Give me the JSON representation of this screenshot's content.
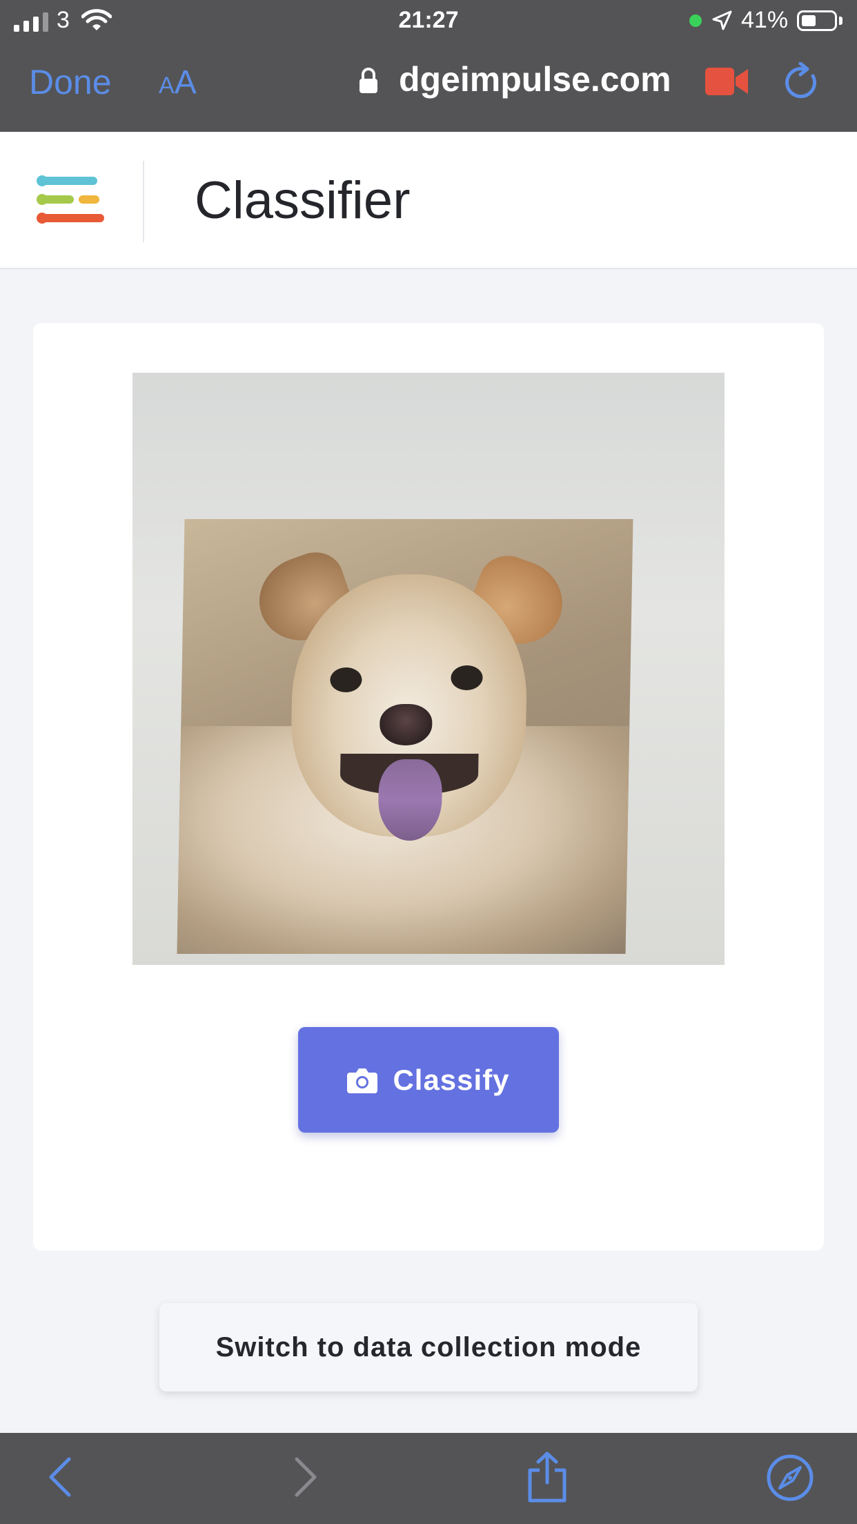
{
  "status_bar": {
    "carrier": "3",
    "time": "21:27",
    "battery": "41%"
  },
  "browser": {
    "done_label": "Done",
    "text_size_small": "A",
    "text_size_large": "A",
    "url": "dgeimpulse.com"
  },
  "page": {
    "title": "Classifier",
    "classify_label": "Classify",
    "switch_label": "Switch to data collection mode"
  },
  "colors": {
    "accent": "#6471e0",
    "safari_blue": "#5b8de8",
    "chrome_bg": "#545456",
    "recording": "#e5523f"
  },
  "icons": {
    "logo": "edge-impulse-logo",
    "camera": "camera-icon",
    "back": "chevron-left-icon",
    "forward": "chevron-right-icon",
    "share": "share-icon",
    "compass": "compass-icon"
  }
}
